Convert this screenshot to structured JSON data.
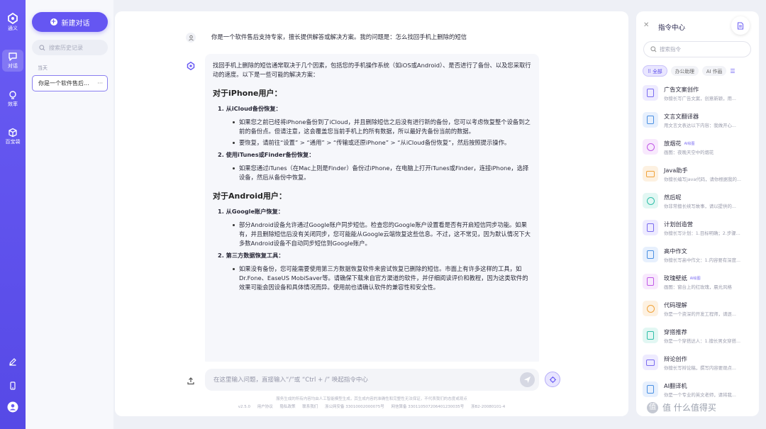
{
  "rail": {
    "brand": "通义",
    "items": [
      {
        "label": "对话",
        "icon": "chat-bubble-icon",
        "active": true
      },
      {
        "label": "效率",
        "icon": "lightbulb-icon"
      },
      {
        "label": "百宝袋",
        "icon": "cube-icon"
      }
    ],
    "bottom_icons": [
      "edit-icon",
      "mobile-icon",
      "user-icon"
    ]
  },
  "sidebar": {
    "new_chat": "新建对话",
    "search_placeholder": "搜索历史记录",
    "group_label": "当天",
    "history": [
      {
        "title": "你是一个软件售后...",
        "more": "···"
      }
    ]
  },
  "conversation": {
    "user_question": "你是一个软件售后支持专家，擅长提供解答或解决方案。我的问题是：怎么找回手机上删除的短信",
    "answer": {
      "intro": "找回手机上删除的短信通常取决于几个因素，包括您的手机操作系统（如iOS或Android）、是否进行了备份、以及您采取行动的速度。以下是一些可能的解决方案：",
      "sections": [
        {
          "heading": "对于iPhone用户：",
          "steps": [
            {
              "title": "1. 从iCloud备份恢复：",
              "bullets": [
                "如果您之前已经将iPhone备份到了iCloud，并且删除短信之后没有进行新的备份，您可以考虑恢复整个设备到之前的备份点。但请注意，这会覆盖您当前手机上的所有数据，所以最好先备份当前的数据。",
                "要恢复，请前往“设置” > “通用” > “传输或还原iPhone” > “从iCloud备份恢复”，然后按照提示操作。"
              ]
            },
            {
              "title": "2. 使用iTunes或Finder备份恢复：",
              "bullets": [
                "如果您通过iTunes（在Mac上则是Finder）备份过iPhone，在电脑上打开iTunes或Finder，连接iPhone，选择设备，然后从备份中恢复。"
              ]
            }
          ]
        },
        {
          "heading": "对于Android用户：",
          "steps": [
            {
              "title": "1. 从Google账户恢复：",
              "bullets": [
                "部分Android设备允许通过Google账户同步短信。检查您的Google账户设置看是否有开启短信同步功能。如果有，并且删除短信后没有关闭同步，您可能能从Google云端恢复这些信息。不过，这不常见，因为默认情况下大多数Android设备不自动同步短信到Google账户。"
              ]
            },
            {
              "title": "2. 第三方数据恢复工具：",
              "bullets": [
                "如果没有备份，您可能需要使用第三方数据恢复软件来尝试恢复已删除的短信。市面上有许多这样的工具，如Dr.Fone、EaseUS MobiSaver等。请确保下载来自官方渠道的软件，并仔细阅读评价和教程，因为这类软件的效果可能会因设备和具体情况而异。使用前也请确认软件的兼容性和安全性。"
              ]
            }
          ]
        }
      ]
    }
  },
  "composer": {
    "placeholder": "在这里输入问题，直接输入“/”或 “Ctrl + /” 唤起指令中心"
  },
  "footer": {
    "disclaimer": "服务生成的所有内容均由人工智能模型生成，其生成内容的准确性和完整性无法保证，不代表我们的态度或观点",
    "links": [
      "v2.5.0",
      "用户协议",
      "隐私政策",
      "联系我们",
      "浙公网安备 33010002000075号",
      "网信算备 330110507206401230035号",
      "浙B2-20080101-4"
    ]
  },
  "command_center": {
    "title": "指令中心",
    "search_placeholder": "搜索指令",
    "tabs": [
      {
        "label": "全部",
        "active": true
      },
      {
        "label": "办公助理"
      },
      {
        "label": "AI 作画"
      }
    ],
    "items": [
      {
        "name": "广告文案创作",
        "desc": "你擅长写广告文案，创意新颖，用...",
        "color": "#7a6cf0",
        "bg": "#eeebff"
      },
      {
        "name": "文言文翻译器",
        "desc": "用文言文表达以下内容：我做开心...",
        "color": "#4a90e2",
        "bg": "#e7f0fd"
      },
      {
        "name": "放烟花",
        "badge": "AI绘图",
        "desc": "画图：夜晚天空中的烟花",
        "color": "#c059e6",
        "bg": "#f8e9fd"
      },
      {
        "name": "Java助手",
        "desc": "你擅长编写java代码，请你根据我的...",
        "color": "#f0a23a",
        "bg": "#fdf1e1"
      },
      {
        "name": "然后呢",
        "desc": "你非常擅长续写故事，请以提供的...",
        "color": "#2fbfa8",
        "bg": "#e2f7f3"
      },
      {
        "name": "计划创造营",
        "desc": "你擅长写计划：1.目标明确；2.步骤...",
        "color": "#7a6cf0",
        "bg": "#eeebff"
      },
      {
        "name": "高中作文",
        "desc": "你擅长写高中作文：1.内容要有深度...",
        "color": "#4a90e2",
        "bg": "#e7f0fd"
      },
      {
        "name": "玫瑰壁纸",
        "badge": "AI绘图",
        "desc": "画图：窗台上的红玫瑰，晨光风格",
        "color": "#c059e6",
        "bg": "#f8e9fd"
      },
      {
        "name": "代码理解",
        "desc": "你是一个资深的开发工程师，请逐...",
        "color": "#f0a23a",
        "bg": "#fdf1e1"
      },
      {
        "name": "穿搭推荐",
        "desc": "你是一个穿搭达人：1.擅长男女穿搭...",
        "color": "#2fbfa8",
        "bg": "#e2f7f3"
      },
      {
        "name": "辩论创作",
        "desc": "你擅长写辩论稿，撰写内容要观点...",
        "color": "#7a6cf0",
        "bg": "#eeebff"
      },
      {
        "name": "AI翻译机",
        "desc": "你是一个专业的英文老师，请将我...",
        "color": "#4a90e2",
        "bg": "#e7f0fd"
      }
    ]
  },
  "watermark": {
    "text": "值 什么值得买",
    "logo": "值"
  }
}
